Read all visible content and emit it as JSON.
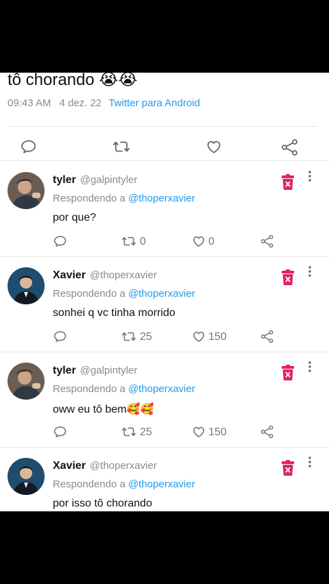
{
  "main_tweet": {
    "text": "tô chorando 😭😭",
    "time": "09:43 AM",
    "date": "4 dez. 22",
    "source": "Twitter para Android"
  },
  "replies": [
    {
      "name": "tyler",
      "handle": "@galpintyler",
      "replying_label": "Respondendo a",
      "replying_to": "@thoperxavier",
      "text": "por que?",
      "retweets": "0",
      "likes": "0"
    },
    {
      "name": "Xavier",
      "handle": "@thoperxavier",
      "replying_label": "Respondendo a",
      "replying_to": "@thoperxavier",
      "text": "sonhei q vc tinha morrido",
      "retweets": "25",
      "likes": "150"
    },
    {
      "name": "tyler",
      "handle": "@galpintyler",
      "replying_label": "Respondendo a",
      "replying_to": "@thoperxavier",
      "text": "oww eu tô bem🥰🥰",
      "retweets": "25",
      "likes": "150"
    },
    {
      "name": "Xavier",
      "handle": "@thoperxavier",
      "replying_label": "Respondendo a",
      "replying_to": "@thoperxavier",
      "text": "por isso tô chorando"
    }
  ],
  "colors": {
    "accent": "#1d9bf0",
    "delete": "#e0245e"
  },
  "icons": [
    "reply-icon",
    "retweet-icon",
    "like-icon",
    "share-icon",
    "delete-icon",
    "more-icon"
  ]
}
